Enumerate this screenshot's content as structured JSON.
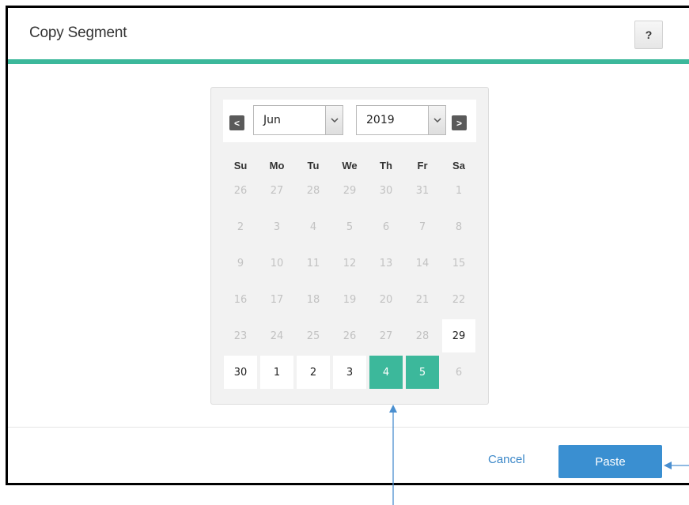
{
  "dialog": {
    "title": "Copy Segment",
    "help_label": "?"
  },
  "calendar": {
    "prev_label": "<",
    "next_label": ">",
    "month_value": "Jun",
    "year_value": "2019",
    "weekdays": [
      "Su",
      "Mo",
      "Tu",
      "We",
      "Th",
      "Fr",
      "Sa"
    ],
    "weeks": [
      [
        {
          "d": "26",
          "s": "muted"
        },
        {
          "d": "27",
          "s": "muted"
        },
        {
          "d": "28",
          "s": "muted"
        },
        {
          "d": "29",
          "s": "muted"
        },
        {
          "d": "30",
          "s": "muted"
        },
        {
          "d": "31",
          "s": "muted"
        },
        {
          "d": "1",
          "s": "muted"
        }
      ],
      [
        {
          "d": "2",
          "s": "muted"
        },
        {
          "d": "3",
          "s": "muted"
        },
        {
          "d": "4",
          "s": "muted"
        },
        {
          "d": "5",
          "s": "muted"
        },
        {
          "d": "6",
          "s": "muted"
        },
        {
          "d": "7",
          "s": "muted"
        },
        {
          "d": "8",
          "s": "muted"
        }
      ],
      [
        {
          "d": "9",
          "s": "muted"
        },
        {
          "d": "10",
          "s": "muted"
        },
        {
          "d": "11",
          "s": "muted"
        },
        {
          "d": "12",
          "s": "muted"
        },
        {
          "d": "13",
          "s": "muted"
        },
        {
          "d": "14",
          "s": "muted"
        },
        {
          "d": "15",
          "s": "muted"
        }
      ],
      [
        {
          "d": "16",
          "s": "muted"
        },
        {
          "d": "17",
          "s": "muted"
        },
        {
          "d": "18",
          "s": "muted"
        },
        {
          "d": "19",
          "s": "muted"
        },
        {
          "d": "20",
          "s": "muted"
        },
        {
          "d": "21",
          "s": "muted"
        },
        {
          "d": "22",
          "s": "muted"
        }
      ],
      [
        {
          "d": "23",
          "s": "muted"
        },
        {
          "d": "24",
          "s": "muted"
        },
        {
          "d": "25",
          "s": "muted"
        },
        {
          "d": "26",
          "s": "muted"
        },
        {
          "d": "27",
          "s": "muted"
        },
        {
          "d": "28",
          "s": "muted"
        },
        {
          "d": "29",
          "s": "avail"
        }
      ],
      [
        {
          "d": "30",
          "s": "avail"
        },
        {
          "d": "1",
          "s": "avail"
        },
        {
          "d": "2",
          "s": "avail"
        },
        {
          "d": "3",
          "s": "avail"
        },
        {
          "d": "4",
          "s": "selected"
        },
        {
          "d": "5",
          "s": "selected"
        },
        {
          "d": "6",
          "s": "muted"
        }
      ]
    ]
  },
  "footer": {
    "cancel_label": "Cancel",
    "paste_label": "Paste"
  },
  "colors": {
    "accent": "#3cb89b",
    "primary_button": "#3a8fd1",
    "link": "#3b87c8",
    "annotation_arrow": "#4a8fd0"
  },
  "icons": {
    "month_dropdown": "chevron-down-icon",
    "year_dropdown": "chevron-down-icon",
    "annotation_1": "arrow-up-annotation",
    "annotation_2": "arrow-left-annotation"
  }
}
